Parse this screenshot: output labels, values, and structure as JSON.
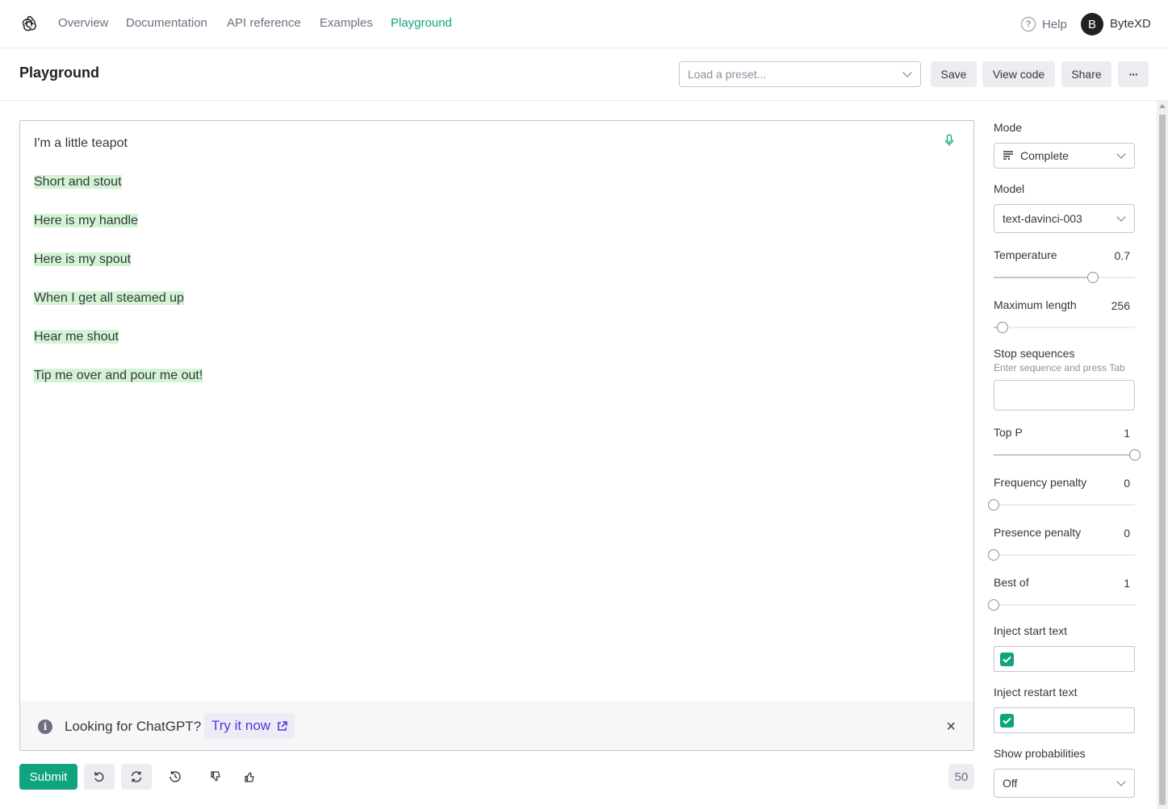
{
  "nav": {
    "logo_icon": "openai-logo-icon",
    "items": [
      "Overview",
      "Documentation",
      "API reference",
      "Examples",
      "Playground"
    ],
    "active": "Playground",
    "help_label": "Help",
    "avatar_letter": "B",
    "username": "ByteXD"
  },
  "header": {
    "title": "Playground",
    "preset_placeholder": "Load a preset...",
    "save_label": "Save",
    "view_code_label": "View code",
    "share_label": "Share",
    "more_label": "···"
  },
  "editor": {
    "prompt_line": "I'm a little teapot",
    "completion_lines": [
      "Short and stout",
      "Here is my handle",
      "Here is my spout",
      "When I get all steamed up",
      "Hear me shout",
      "Tip me over and pour me out!"
    ],
    "highlight_color": "#d2f4d3",
    "banner": {
      "text": "Looking for ChatGPT?",
      "link_label": "Try it now"
    }
  },
  "footer": {
    "submit_label": "Submit",
    "token_count": "50"
  },
  "settings": {
    "mode_label": "Mode",
    "mode_value": "Complete",
    "model_label": "Model",
    "model_value": "text-davinci-003",
    "temperature_label": "Temperature",
    "temperature_value": "0.7",
    "temperature_fraction": 0.7,
    "max_length_label": "Maximum length",
    "max_length_value": "256",
    "max_length_fraction": 0.06,
    "stop_label": "Stop sequences",
    "stop_hint": "Enter sequence and press Tab",
    "top_p_label": "Top P",
    "top_p_value": "1",
    "top_p_fraction": 1.0,
    "freq_label": "Frequency penalty",
    "freq_value": "0",
    "freq_fraction": 0.0,
    "presence_label": "Presence penalty",
    "presence_value": "0",
    "presence_fraction": 0.0,
    "best_of_label": "Best of",
    "best_of_value": "1",
    "best_of_fraction": 0.0,
    "inject_start_label": "Inject start text",
    "inject_start_checked": true,
    "inject_restart_label": "Inject restart text",
    "inject_restart_checked": true,
    "show_prob_label": "Show probabilities",
    "show_prob_value": "Off"
  },
  "colors": {
    "accent": "#10a37f",
    "link": "#5436da"
  }
}
